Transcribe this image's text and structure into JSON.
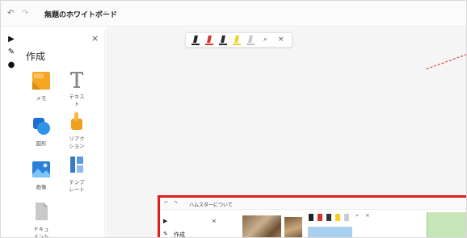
{
  "window": {
    "title": "無題のホワイトボード",
    "undo_icon": "undo-icon",
    "redo_icon": "redo-icon",
    "chevron_icon": "chevron-down-icon"
  },
  "toolstrip": [
    {
      "name": "select-tool",
      "glyph": "▶"
    },
    {
      "name": "pen-tool",
      "glyph": "✎"
    },
    {
      "name": "lasso-tool",
      "glyph": "●"
    }
  ],
  "panel": {
    "title": "作成",
    "close_glyph": "×",
    "items": [
      {
        "label": "メモ",
        "icon": "sticky-note-icon"
      },
      {
        "label": "テキス\nト",
        "icon": "text-icon"
      },
      {
        "label": "図形",
        "icon": "shapes-icon"
      },
      {
        "label": "リアク\nション",
        "icon": "reaction-icon"
      },
      {
        "label": "画像",
        "icon": "image-icon"
      },
      {
        "label": "テンプ\nレート",
        "icon": "template-icon"
      },
      {
        "label": "ドキュ\nメント",
        "icon": "document-icon"
      }
    ]
  },
  "pen_toolbar": {
    "pens": [
      {
        "name": "black-pen",
        "color": "#222222"
      },
      {
        "name": "red-pen",
        "color": "#d6352b"
      },
      {
        "name": "dark-pen",
        "color": "#2b2b2b"
      },
      {
        "name": "yellow-highlighter",
        "color": "#f2d024"
      },
      {
        "name": "eraser",
        "color": "#bfbfbf"
      }
    ],
    "search_glyph": "⌕",
    "close_glyph": "×"
  },
  "nested": {
    "title": "ハムスターについて",
    "side_create": "作成",
    "select_glyph": "▶",
    "pen_glyph": "✎",
    "close_glyph": "×"
  },
  "colors": {
    "accent_red": "#e01e1e"
  }
}
